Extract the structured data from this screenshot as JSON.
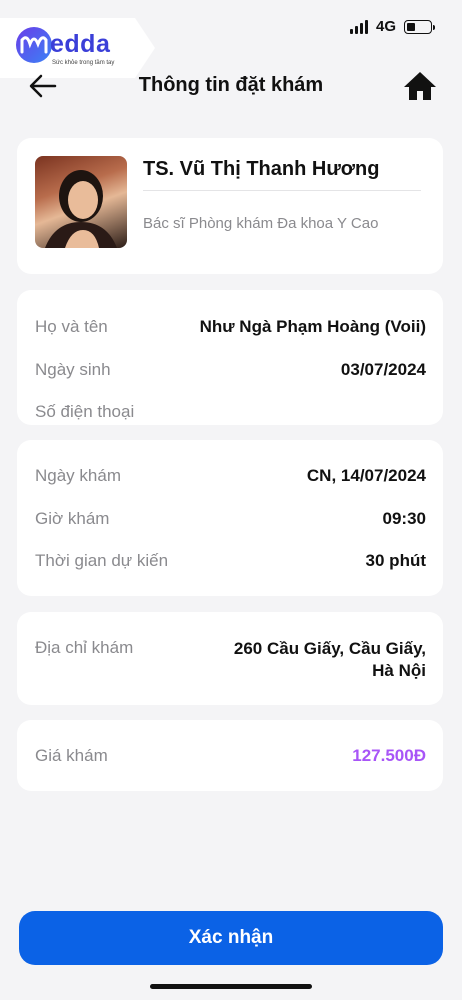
{
  "status": {
    "network": "4G",
    "battery_level": 0.35
  },
  "logo": {
    "text": "edda",
    "tagline": "Sức khỏe trong tầm tay"
  },
  "header": {
    "title": "Thông tin đặt khám"
  },
  "doctor": {
    "name": "TS. Vũ Thị Thanh Hương",
    "description": "Bác sĩ Phòng khám Đa khoa Y Cao"
  },
  "patient": {
    "name_label": "Họ và tên",
    "name_value": "Như Ngà Phạm Hoàng (Voii)",
    "dob_label": "Ngày sinh",
    "dob_value": "03/07/2024",
    "phone_label": "Số điện thoại",
    "phone_value": ""
  },
  "appointment": {
    "date_label": "Ngày khám",
    "date_value": "CN, 14/07/2024",
    "time_label": "Giờ khám",
    "time_value": "09:30",
    "duration_label": "Thời gian dự kiến",
    "duration_value": "30 phút"
  },
  "address": {
    "label": "Địa chỉ khám",
    "line1": "260 Cầu Giấy, Cầu Giấy,",
    "line2": "Hà Nội"
  },
  "fee": {
    "label": "Giá khám",
    "value": "127.500Đ",
    "color": "#a855f7"
  },
  "actions": {
    "confirm_label": "Xác nhận"
  },
  "colors": {
    "primary": "#0b62e6",
    "background": "#f4f4f6"
  }
}
